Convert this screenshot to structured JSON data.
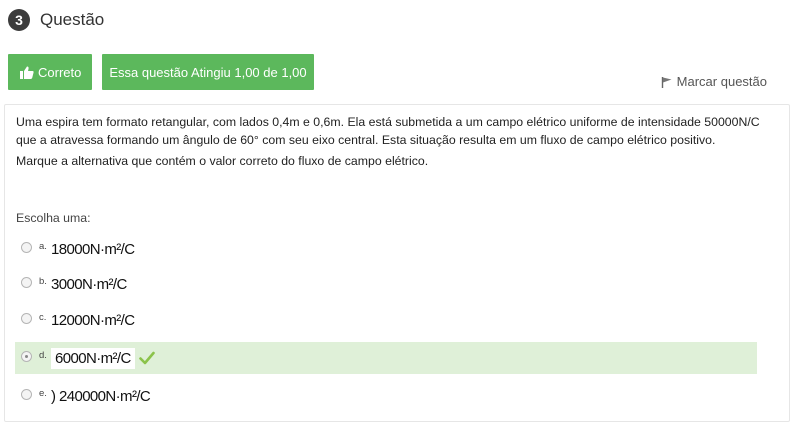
{
  "question": {
    "number": "3",
    "title": "Questão"
  },
  "buttons": {
    "correct_label": "Correto",
    "score_label": "Essa questão Atingiu 1,00 de 1,00"
  },
  "flag": {
    "label": "Marcar questão"
  },
  "body": {
    "paragraph1": "Uma espira tem formato retangular, com lados 0,4m e 0,6m. Ela está submetida a um campo elétrico uniforme de intensidade 50000N/C que a atravessa formando um ângulo de 60° com seu eixo central. Esta situação resulta em um fluxo de campo elétrico positivo.",
    "paragraph2": "Marque a alternativa que contém o valor correto do fluxo de campo elétrico."
  },
  "choose_label": "Escolha uma:",
  "options": [
    {
      "letter": "a.",
      "value": "18000N·m²/C",
      "selected": false
    },
    {
      "letter": "b.",
      "value": "3000N·m²/C",
      "selected": false
    },
    {
      "letter": "c.",
      "value": "12000N·m²/C",
      "selected": false
    },
    {
      "letter": "d.",
      "value": "6000N·m²/C",
      "selected": true
    },
    {
      "letter": "e.",
      "value": ") 240000N·m²/C",
      "selected": false
    }
  ],
  "colors": {
    "success_green": "#5cb85c",
    "selected_bg": "#dff0d8",
    "check_green": "#8bc34a"
  },
  "icons": [
    "thumbs-up-icon",
    "flag-icon",
    "check-icon"
  ]
}
